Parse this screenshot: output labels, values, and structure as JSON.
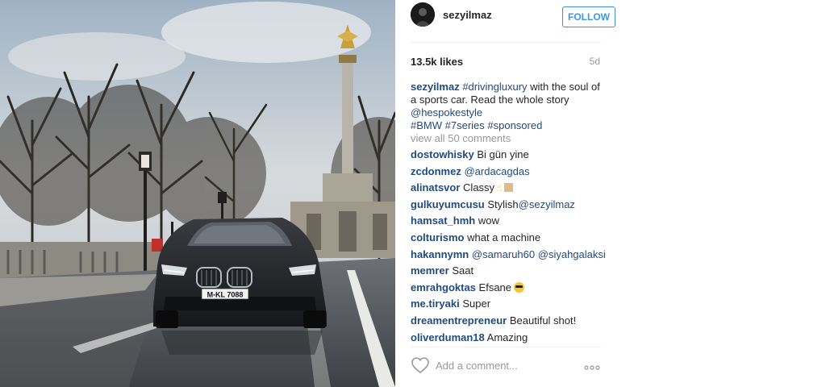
{
  "post": {
    "author": "sezyilmaz",
    "follow_label": "FOLLOW",
    "likes": "13.5k likes",
    "age": "5d",
    "caption": {
      "user": "sezyilmaz",
      "tag1": "#drivingluxury",
      "text1": " with the soul of a sports car. Read the whole story ",
      "mention": "@hespokestyle",
      "tag2": "#BMW",
      "tag3": "#7series",
      "tag4": "#sponsored"
    },
    "view_all": "view all 50 comments",
    "comment_placeholder": "Add a comment...",
    "photo": {
      "license_plate": "M-KL 7088"
    }
  },
  "comments": [
    {
      "user": "dostowhisky",
      "text": "Bi gün yine"
    },
    {
      "user": "zcdonmez",
      "mention": "@ardacagdas"
    },
    {
      "user": "alinatsvor",
      "text": "Classy",
      "emoji": "thumbs-up"
    },
    {
      "user": "gulkuyumcusu",
      "text": "Stylish",
      "mention": "@sezyilmaz"
    },
    {
      "user": "hamsat_hmh",
      "text": "wow"
    },
    {
      "user": "colturismo",
      "text": "what a machine"
    },
    {
      "user": "hakannymn",
      "mention": "@samaruh60",
      "mention2": "@siyahgalaksi"
    },
    {
      "user": "memrer",
      "text": "Saat"
    },
    {
      "user": "emrahgoktas",
      "text": "Efsane",
      "emoji": "sunglasses"
    },
    {
      "user": "me.tiryaki",
      "text": "Super"
    },
    {
      "user": "dreamentrepreneur",
      "text": "Beautiful shot!"
    },
    {
      "user": "oliverduman18",
      "text": "Amazing"
    }
  ],
  "colors": {
    "link": "#1f4b80",
    "follow": "#3897f0",
    "muted": "#999999"
  }
}
